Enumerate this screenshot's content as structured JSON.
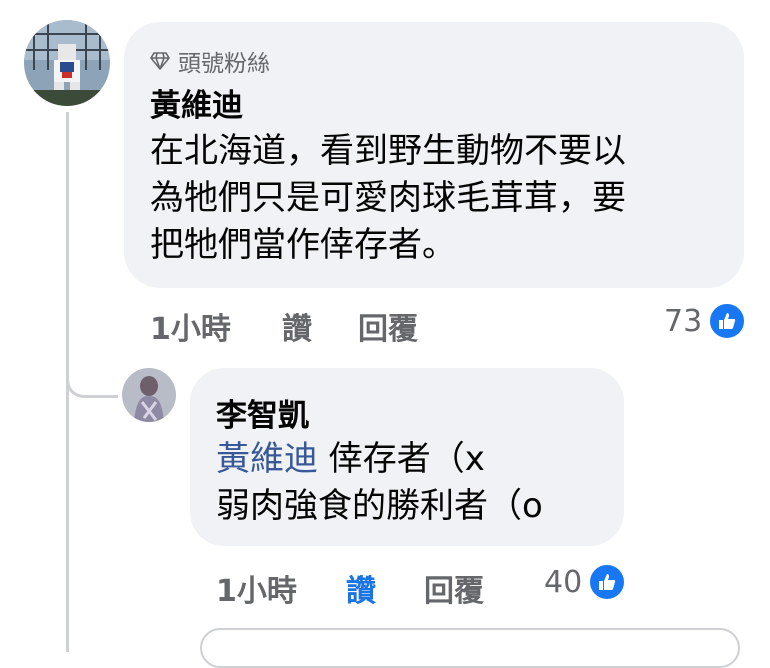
{
  "comment": {
    "badge_label": "頭號粉絲",
    "author": "黃維迪",
    "lines": [
      "在北海道，看到野生動物不要以",
      "為牠們只是可愛肉球毛茸茸，要",
      "把牠們當作倖存者。"
    ],
    "time": "1小時",
    "like_label": "讚",
    "reply_label": "回覆",
    "reaction_count": "73"
  },
  "reply": {
    "author": "李智凱",
    "mention": "黃維迪",
    "line1_rest": " 倖存者（x",
    "line2": "弱肉強食的勝利者（o",
    "time": "1小時",
    "like_label": "讚",
    "reply_label": "回覆",
    "reaction_count": "40"
  },
  "colors": {
    "bubble_bg": "#f0f2f5",
    "meta_gray": "#65676b",
    "like_blue": "#1b74e4",
    "mention_blue": "#385898",
    "reaction_blue": "#1877f2"
  },
  "icons": [
    "diamond-icon",
    "thumbs-up-reaction-icon"
  ]
}
